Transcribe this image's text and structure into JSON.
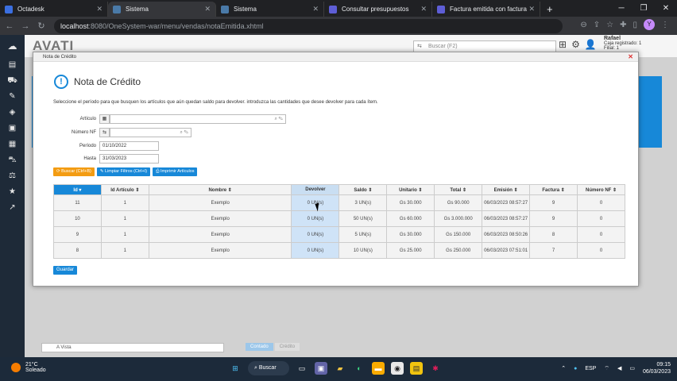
{
  "browser": {
    "tabs": [
      {
        "title": "Octadesk",
        "color": "#3b6fe0",
        "active": false
      },
      {
        "title": "Sistema",
        "color": "#4a7aa8",
        "active": true
      },
      {
        "title": "Sistema",
        "color": "#4a7aa8",
        "active": false
      },
      {
        "title": "Consultar presupuestos",
        "color": "#5e5ed6",
        "active": false
      },
      {
        "title": "Factura emitida con factura",
        "color": "#5e5ed6",
        "active": false
      }
    ],
    "url_host": "localhost",
    "url_path": ":8080/OneSystem-war/menu/vendas/notaEmitida.xhtml",
    "profile_letter": "Y"
  },
  "app": {
    "logo": "AVATI",
    "search_placeholder": "Buscar (F2)",
    "user_name": "Rafael",
    "user_sub1": "Caja registrado: 1",
    "user_sub2": "Filial: 1",
    "bg_input": "A Vista",
    "bg_btn1": "Contado",
    "bg_btn2": "Crédito"
  },
  "dialog": {
    "header": "Nota de Crédito",
    "title": "Nota de Crédito",
    "instructions": "Seleccione el período para que busquen los artículos que aún quedan saldo para devolver. introduzca las cantidades que desee devolver para cada ítem.",
    "labels": {
      "articulo": "Artículo",
      "numero_nf": "Número NF",
      "periodo": "Período",
      "hasta": "Hasta"
    },
    "values": {
      "periodo": "01/10/2022",
      "hasta": "31/03/2023"
    },
    "buttons": {
      "buscar": "Buscar (Ctrl+B)",
      "limpiar": "Limpiar Filtros (Ctrl+I)",
      "imprimir": "Imprimir Artículos",
      "guardar": "Guardar"
    }
  },
  "table": {
    "headers": [
      "Id",
      "Id Artículo",
      "Nombre",
      "Devolver",
      "Saldo",
      "Unitario",
      "Total",
      "Emisión",
      "Factura",
      "Número NF"
    ],
    "rows": [
      [
        "11",
        "1",
        "Exemplo",
        "0 UN(s)",
        "3 UN(s)",
        "Gs 30.000",
        "Gs 90.000",
        "06/03/2023 08:57:27",
        "9",
        "0"
      ],
      [
        "10",
        "1",
        "Exemplo",
        "0 UN(s)",
        "50 UN(s)",
        "Gs 60.000",
        "Gs 3.000.000",
        "06/03/2023 08:57:27",
        "9",
        "0"
      ],
      [
        "9",
        "1",
        "Exemplo",
        "0 UN(s)",
        "5 UN(s)",
        "Gs 30.000",
        "Gs 150.000",
        "06/03/2023 08:50:26",
        "8",
        "0"
      ],
      [
        "8",
        "1",
        "Exemplo",
        "0 UN(s)",
        "10 UN(s)",
        "Gs 25.000",
        "Gs 250.000",
        "06/03/2023 07:51:01",
        "7",
        "0"
      ]
    ]
  },
  "taskbar": {
    "temp": "21°C",
    "weather": "Soleado",
    "search": "Buscar",
    "lang": "ESP",
    "time": "09:15",
    "date": "06/03/2023"
  }
}
